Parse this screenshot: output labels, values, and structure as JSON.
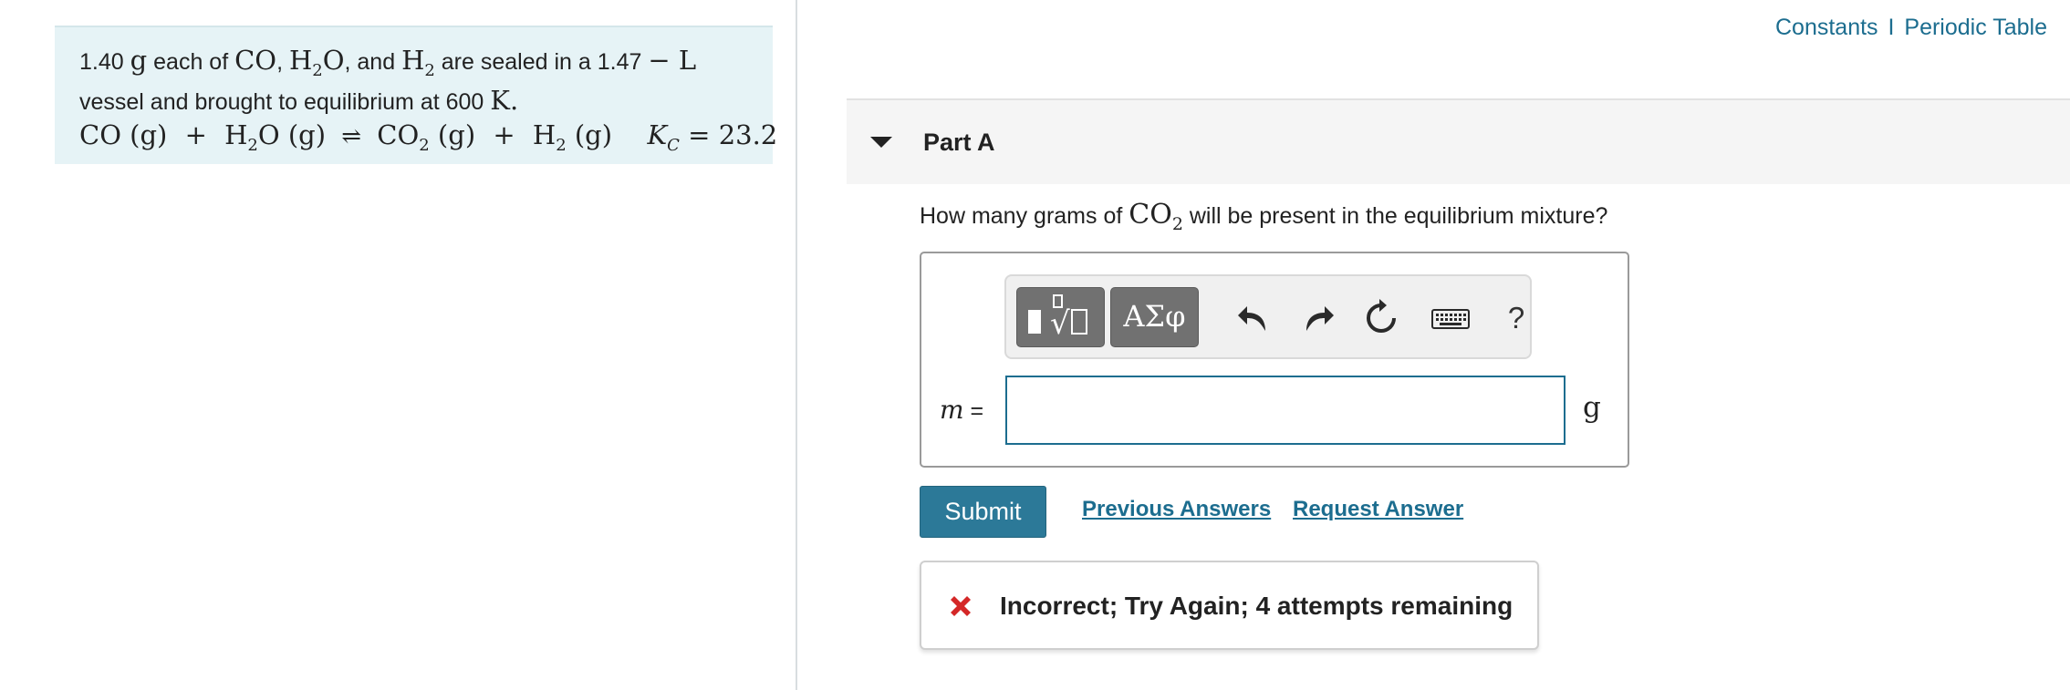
{
  "problem": {
    "mass": "1.40",
    "mass_unit": "g",
    "text_each_of": " each of ",
    "species1": "CO",
    "sep1": ", ",
    "species2_a": "H",
    "species2_sub": "2",
    "species2_b": "O",
    "text_and": ", and ",
    "species3_a": "H",
    "species3_sub": "2",
    "text_sealed": "  are sealed in a 1.47 ",
    "volume_unit": "− L",
    "line2_a": "vessel and brought to equilibrium at 600 ",
    "temp_unit": "K",
    "line2_end": ".",
    "eq_co": "CO (g)",
    "eq_plus1": "+",
    "eq_h2o_a": "H",
    "eq_h2o_sub": "2",
    "eq_h2o_b": "O (g)",
    "eq_arrow": "⇌",
    "eq_co2_a": "CO",
    "eq_co2_sub": "2",
    "eq_co2_b": " (g)",
    "eq_plus2": "+",
    "eq_h2_a": "H",
    "eq_h2_sub": "2",
    "eq_h2_b": " (g)",
    "k_label": "K",
    "k_sub": "C",
    "k_value": " = 23.2"
  },
  "header_links": {
    "constants": "Constants",
    "separator": "I",
    "periodic_table": "Periodic Table"
  },
  "part": {
    "title": "Part A"
  },
  "question": {
    "text_before": "How many grams of ",
    "species_a": "CO",
    "species_sub": "2",
    "text_after": " will be present in the equilibrium mixture?"
  },
  "answer": {
    "toolbar_greek_label": "ΑΣφ",
    "help_label": "?",
    "variable": "m",
    "equals": " =",
    "input_value": "",
    "unit": "g"
  },
  "actions": {
    "submit_label": "Submit",
    "previous_answers": "Previous Answers",
    "request_answer": "Request Answer"
  },
  "feedback": {
    "message": "Incorrect; Try Again; 4 attempts remaining"
  },
  "colors": {
    "link": "#1c6d8f",
    "submit_bg": "#2c7998",
    "problem_bg": "#e6f3f6",
    "error": "#d42727"
  }
}
